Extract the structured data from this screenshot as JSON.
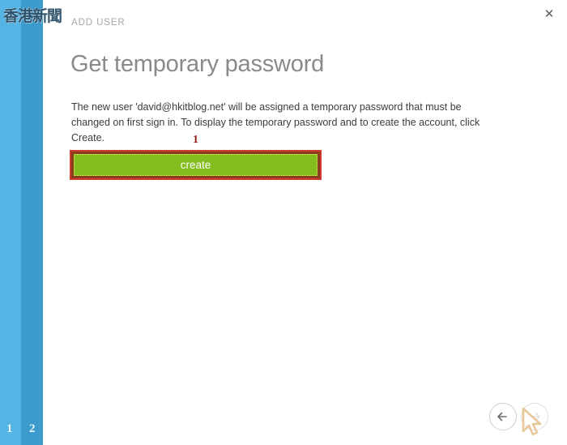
{
  "window": {
    "app_watermark": "香港新聞",
    "close_label": "✕"
  },
  "wizard": {
    "eyebrow": "ADD USER",
    "title": "Get temporary password",
    "body": "The new user 'david@hkitblog.net' will be assigned a temporary password that must be changed on first sign in. To display the temporary password and to create the account, click Create.",
    "steps": [
      {
        "number": "1",
        "color": "#54b4e4"
      },
      {
        "number": "2",
        "color": "#3a9bcc"
      }
    ]
  },
  "actions": {
    "create_label": "create",
    "create_color": "#84bd1f",
    "create_text_color": "#ffffff"
  },
  "annotation": {
    "step_number": "1",
    "border_color": "#d03a2a",
    "number_color": "#8c2118"
  },
  "navigation": {
    "back_icon": "arrow-left-icon",
    "next_icon": "arrow-right-icon",
    "cursor_icon": "mouse-pointer-icon"
  }
}
